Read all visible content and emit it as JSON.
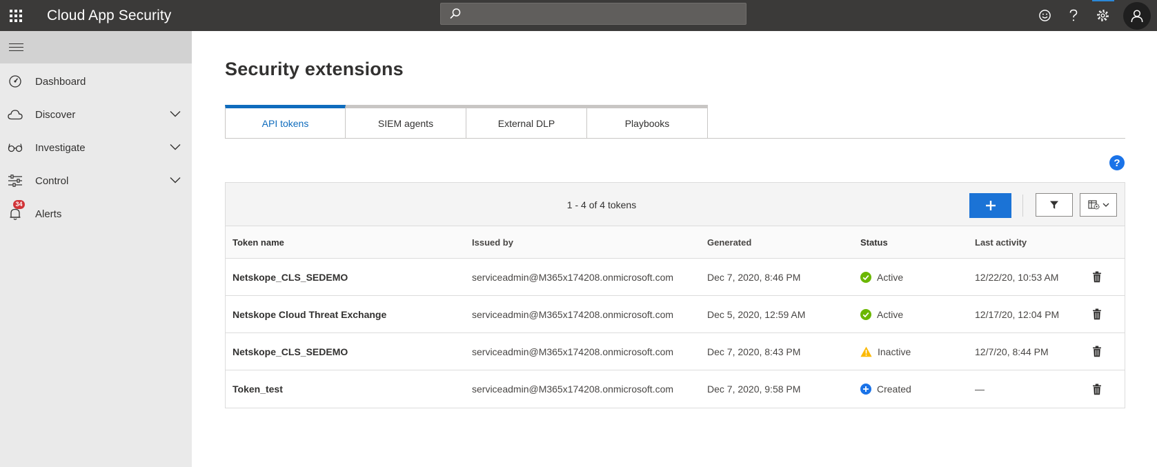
{
  "app": {
    "title": "Cloud App Security"
  },
  "search": {
    "placeholder": ""
  },
  "sidebar": {
    "items": [
      {
        "label": "Dashboard",
        "icon": "dashboard-icon"
      },
      {
        "label": "Discover",
        "icon": "cloud-icon"
      },
      {
        "label": "Investigate",
        "icon": "glasses-icon"
      },
      {
        "label": "Control",
        "icon": "sliders-icon"
      },
      {
        "label": "Alerts",
        "icon": "bell-icon",
        "badge": "34"
      }
    ]
  },
  "page": {
    "title": "Security extensions"
  },
  "tabs": [
    {
      "label": "API tokens",
      "active": true
    },
    {
      "label": "SIEM agents",
      "active": false
    },
    {
      "label": "External DLP",
      "active": false
    },
    {
      "label": "Playbooks",
      "active": false
    }
  ],
  "help": {
    "label": "?"
  },
  "table": {
    "count_text": "1 - 4 of 4 tokens",
    "columns": [
      "Token name",
      "Issued by",
      "Generated",
      "Status",
      "Last activity"
    ],
    "rows": [
      {
        "name": "Netskope_CLS_SEDEMO",
        "issued_by": "serviceadmin@M365x174208.onmicrosoft.com",
        "generated": "Dec 7, 2020, 8:46 PM",
        "status": "Active",
        "status_icon": "check-circle-icon",
        "last_activity": "12/22/20, 10:53 AM"
      },
      {
        "name": "Netskope Cloud Threat Exchange",
        "issued_by": "serviceadmin@M365x174208.onmicrosoft.com",
        "generated": "Dec 5, 2020, 12:59 AM",
        "status": "Active",
        "status_icon": "check-circle-icon",
        "last_activity": "12/17/20, 12:04 PM"
      },
      {
        "name": "Netskope_CLS_SEDEMO",
        "issued_by": "serviceadmin@M365x174208.onmicrosoft.com",
        "generated": "Dec 7, 2020, 8:43 PM",
        "status": "Inactive",
        "status_icon": "warning-icon",
        "last_activity": "12/7/20, 8:44 PM"
      },
      {
        "name": "Token_test",
        "issued_by": "serviceadmin@M365x174208.onmicrosoft.com",
        "generated": "Dec 7, 2020, 9:58 PM",
        "status": "Created",
        "status_icon": "plus-circle-icon",
        "last_activity": "—"
      }
    ]
  },
  "colors": {
    "topbar": "#3b3a39",
    "accent": "#0f6cbd",
    "add_button": "#1b73d6",
    "active_status": "#6bb700",
    "warning_status": "#fcb900",
    "created_status": "#1a73e8",
    "badge": "#d13438"
  }
}
